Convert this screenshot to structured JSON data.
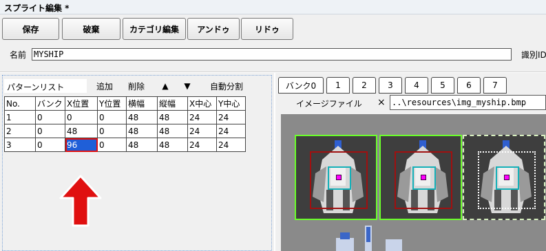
{
  "window": {
    "title": "スプライト編集 *"
  },
  "toolbar": {
    "buttons": [
      "保存",
      "破棄",
      "カテゴリ編集",
      "アンドゥ",
      "リドゥ"
    ]
  },
  "name_row": {
    "label": "名前",
    "value": "MYSHIP",
    "id_label": "識別ID"
  },
  "pattern_list": {
    "title": "パターンリスト",
    "actions": [
      "追加",
      "削除",
      "▲",
      "▼",
      "自動分割"
    ],
    "columns": [
      "No.",
      "バンク",
      "X位置",
      "Y位置",
      "横幅",
      "縦幅",
      "X中心",
      "Y中心"
    ],
    "rows": [
      [
        "1",
        "0",
        "0",
        "0",
        "48",
        "48",
        "24",
        "24"
      ],
      [
        "2",
        "0",
        "48",
        "0",
        "48",
        "48",
        "24",
        "24"
      ],
      [
        "3",
        "0",
        "96",
        "0",
        "48",
        "48",
        "24",
        "24"
      ]
    ],
    "selected_cell": {
      "row": 3,
      "column": "X位置"
    }
  },
  "bank_panel": {
    "tabs": [
      "バンク0",
      "1",
      "2",
      "3",
      "4",
      "5",
      "6",
      "7"
    ],
    "image_label": "イメージファイル",
    "image_close": "×",
    "image_path": "..\\resources\\img_myship.bmp"
  },
  "annotation": {
    "arrow_color": "#e01010"
  },
  "colors": {
    "selection": "#1f5fd8",
    "frame_green": "#6bff2a",
    "box_red": "#a01010",
    "center_cyan": "#14b0b8"
  }
}
